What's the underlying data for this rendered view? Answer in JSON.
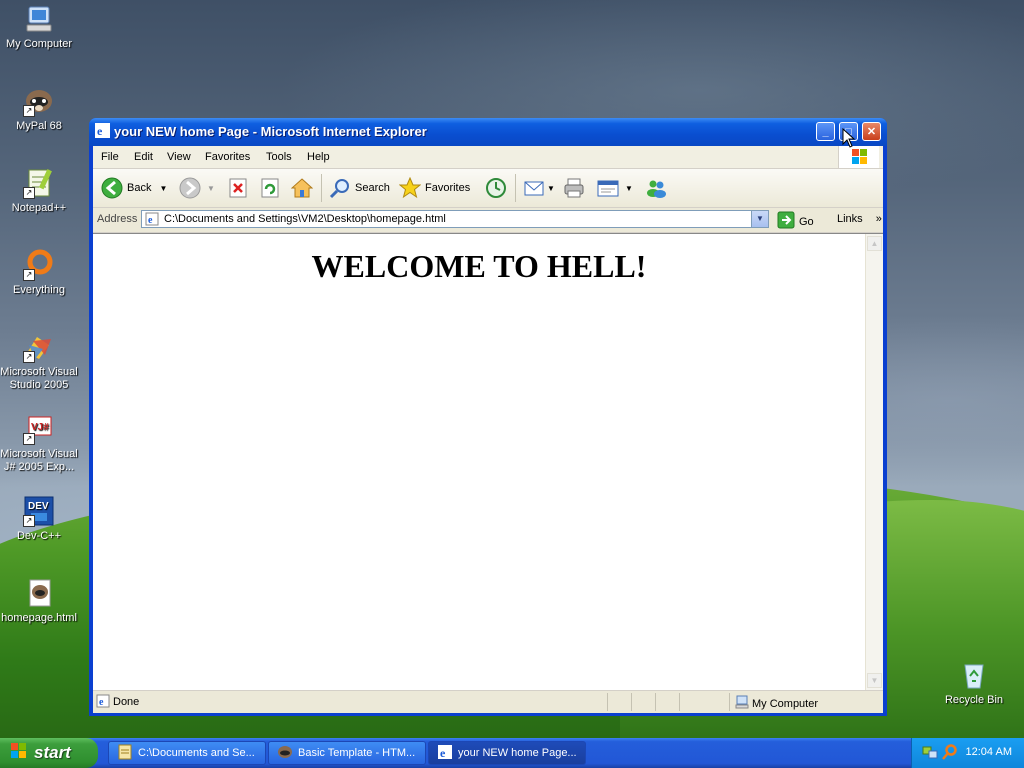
{
  "desktop": {
    "icons": [
      {
        "label": "My Computer"
      },
      {
        "label": "MyPal 68"
      },
      {
        "label": "Notepad++"
      },
      {
        "label": "Everything"
      },
      {
        "label": "Microsoft Visual Studio 2005"
      },
      {
        "label": "Microsoft Visual J# 2005 Exp..."
      },
      {
        "label": "Dev-C++"
      },
      {
        "label": "homepage.html"
      },
      {
        "label": "Recycle Bin"
      }
    ]
  },
  "window": {
    "title": "your NEW home Page - Microsoft Internet Explorer",
    "menu": [
      "File",
      "Edit",
      "View",
      "Favorites",
      "Tools",
      "Help"
    ],
    "toolbar": {
      "back_label": "Back",
      "search_label": "Search",
      "favorites_label": "Favorites"
    },
    "address": {
      "label": "Address",
      "value": "C:\\Documents and Settings\\VM2\\Desktop\\homepage.html",
      "go_label": "Go",
      "links_label": "Links"
    },
    "page": {
      "heading": "WELCOME TO HELL!"
    },
    "status": {
      "text": "Done",
      "zone": "My Computer"
    }
  },
  "taskbar": {
    "start_label": "start",
    "tasks": [
      {
        "label": "C:\\Documents and Se..."
      },
      {
        "label": "Basic Template - HTM..."
      },
      {
        "label": "your NEW home Page..."
      }
    ],
    "clock": "12:04 AM"
  },
  "colors": {
    "titlebar": "#0a4ed0",
    "taskbar": "#245edb",
    "start": "#3c9e3c",
    "tray": "#0f86db"
  }
}
